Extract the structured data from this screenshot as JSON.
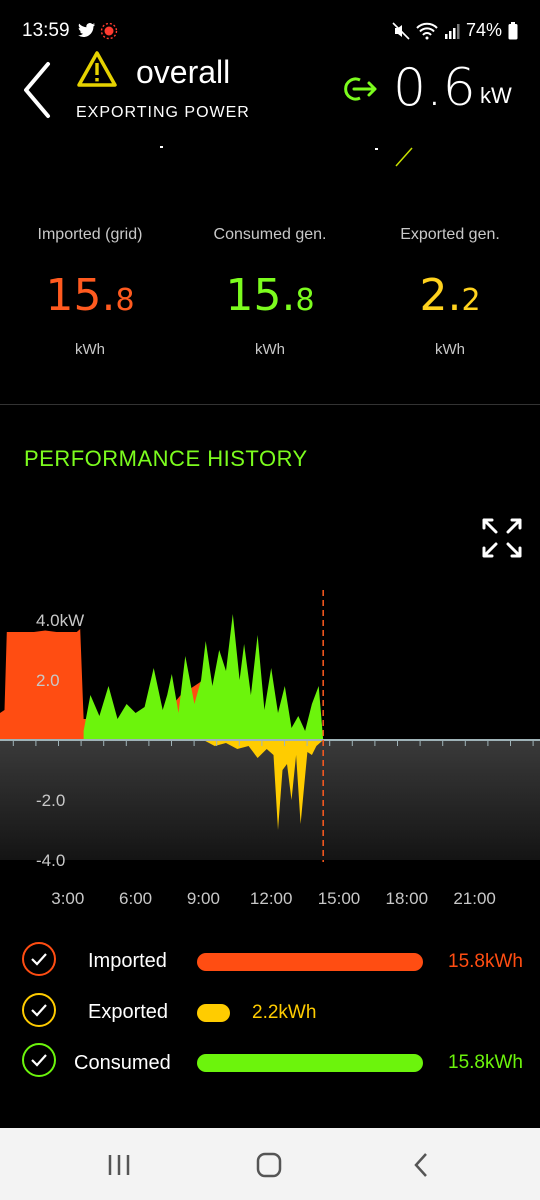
{
  "status": {
    "time": "13:59",
    "battery": "74%"
  },
  "header": {
    "title": "overall",
    "subtitle": "EXPORTING POWER",
    "power_value": "0.6",
    "power_unit": "kW"
  },
  "summary": [
    {
      "label": "Imported (grid)",
      "value_int": "15.",
      "value_dec": "8",
      "unit": "kWh",
      "color": "#ff5a1f"
    },
    {
      "label": "Consumed gen.",
      "value_int": "15.",
      "value_dec": "8",
      "unit": "kWh",
      "color": "#7cfc1e"
    },
    {
      "label": "Exported gen.",
      "value_int": "2.",
      "value_dec": "2",
      "unit": "kWh",
      "color": "#ffd21e"
    }
  ],
  "section_title": "PERFORMANCE HISTORY",
  "chart_data": {
    "type": "area",
    "x_ticks": [
      "3:00",
      "6:00",
      "9:00",
      "12:00",
      "15:00",
      "18:00",
      "21:00"
    ],
    "y_ticks": [
      "4.0kW",
      "2.0",
      "-2.0",
      "-4.0"
    ],
    "ylim": [
      -4.5,
      4.5
    ],
    "now_hour": 14.3,
    "series": [
      {
        "name": "Imported",
        "color": "#ff4d12",
        "x": [
          0,
          0.2,
          0.3,
          0.5,
          1.0,
          1.5,
          2.0,
          2.5,
          3.0,
          3.4,
          3.55,
          3.7,
          4.0,
          5.0,
          6.0,
          7.0,
          8.0,
          9.0,
          10.0
        ],
        "y": [
          0.9,
          1.0,
          3.6,
          3.6,
          3.6,
          3.6,
          3.65,
          3.6,
          3.6,
          3.6,
          3.7,
          0.7,
          0.7,
          0.6,
          0.6,
          0.6,
          1.5,
          2.0,
          1.0
        ]
      },
      {
        "name": "Consumed",
        "color": "#6cf40c",
        "x": [
          3.7,
          4.0,
          4.4,
          4.8,
          5.2,
          5.6,
          6.0,
          6.4,
          6.8,
          7.2,
          7.4,
          7.6,
          7.9,
          8.2,
          8.6,
          8.9,
          9.1,
          9.4,
          9.7,
          10.0,
          10.3,
          10.6,
          10.8,
          11.1,
          11.4,
          11.7,
          12.0,
          12.3,
          12.6,
          12.9,
          13.2,
          13.5,
          13.8,
          14.1,
          14.3
        ],
        "y": [
          0.3,
          1.5,
          0.8,
          1.8,
          0.7,
          1.2,
          0.9,
          1.1,
          2.4,
          1.0,
          1.5,
          2.2,
          0.9,
          2.8,
          1.2,
          2.0,
          3.3,
          1.8,
          3.0,
          2.3,
          4.2,
          2.0,
          3.2,
          1.5,
          3.5,
          1.0,
          2.4,
          0.9,
          1.8,
          0.4,
          0.8,
          0.3,
          1.2,
          1.8,
          0.0
        ]
      },
      {
        "name": "Exported",
        "color": "#ffcc00",
        "x": [
          9.0,
          9.5,
          10.0,
          10.5,
          11.0,
          11.4,
          11.8,
          12.1,
          12.3,
          12.5,
          12.7,
          12.9,
          13.1,
          13.3,
          13.5,
          13.6,
          13.8,
          14.0,
          14.3
        ],
        "y": [
          0,
          -0.2,
          -0.1,
          -0.3,
          -0.2,
          -0.6,
          -0.3,
          -0.5,
          -3.0,
          -1.0,
          -0.8,
          -2.0,
          -0.5,
          -2.8,
          -1.2,
          -0.4,
          -0.5,
          -0.2,
          0
        ]
      }
    ]
  },
  "legend": [
    {
      "label": "Imported",
      "value": "15.8kWh",
      "color": "#ff4d12",
      "fraction": 1.0
    },
    {
      "label": "Exported",
      "value": "2.2kWh",
      "color": "#ffcc00",
      "fraction": 0.14
    },
    {
      "label": "Consumed",
      "value": "15.8kWh",
      "color": "#6cf40c",
      "fraction": 1.0
    }
  ]
}
